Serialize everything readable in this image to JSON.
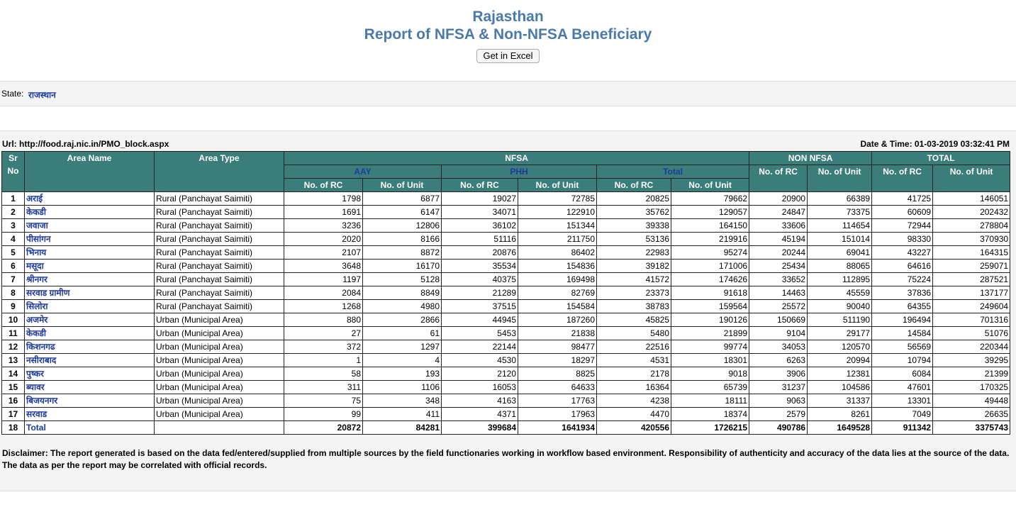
{
  "header": {
    "title": "Rajasthan",
    "subtitle": "Report of NFSA & Non-NFSA Beneficiary",
    "excel_button": "Get in Excel"
  },
  "state": {
    "label": "State:",
    "value": "राजस्थान"
  },
  "url": "Url: http://food.raj.nic.in/PMO_block.aspx",
  "datetime": "Date & Time: 01-03-2019 03:32:41 PM",
  "table": {
    "h_sr": "Sr No",
    "h_area": "Area Name",
    "h_type": "Area Type",
    "h_nfsa": "NFSA",
    "h_non": "NON NFSA",
    "h_total": "TOTAL",
    "h_aay": "AAY",
    "h_phh": "PHH",
    "h_ntotal": "Total",
    "rc": "No. of RC",
    "unit": "No. of Unit",
    "rows": [
      [
        "1",
        "अराई",
        "Rural (Panchayat Saimiti)",
        "1798",
        "6877",
        "19027",
        "72785",
        "20825",
        "79662",
        "20900",
        "66389",
        "41725",
        "146051"
      ],
      [
        "2",
        "केकडी",
        "Rural (Panchayat Saimiti)",
        "1691",
        "6147",
        "34071",
        "122910",
        "35762",
        "129057",
        "24847",
        "73375",
        "60609",
        "202432"
      ],
      [
        "3",
        "जवाजा",
        "Rural (Panchayat Saimiti)",
        "3236",
        "12806",
        "36102",
        "151344",
        "39338",
        "164150",
        "33606",
        "114654",
        "72944",
        "278804"
      ],
      [
        "4",
        "पीसांगन",
        "Rural (Panchayat Saimiti)",
        "2020",
        "8166",
        "51116",
        "211750",
        "53136",
        "219916",
        "45194",
        "151014",
        "98330",
        "370930"
      ],
      [
        "5",
        "भिनाय",
        "Rural (Panchayat Saimiti)",
        "2107",
        "8872",
        "20876",
        "86402",
        "22983",
        "95274",
        "20244",
        "69041",
        "43227",
        "164315"
      ],
      [
        "6",
        "मसूदा",
        "Rural (Panchayat Saimiti)",
        "3648",
        "16170",
        "35534",
        "154836",
        "39182",
        "171006",
        "25434",
        "88065",
        "64616",
        "259071"
      ],
      [
        "7",
        "श्रीनगर",
        "Rural (Panchayat Saimiti)",
        "1197",
        "5128",
        "40375",
        "169498",
        "41572",
        "174626",
        "33652",
        "112895",
        "75224",
        "287521"
      ],
      [
        "8",
        "सरवाड ग्रामीण",
        "Rural (Panchayat Saimiti)",
        "2084",
        "8849",
        "21289",
        "82769",
        "23373",
        "91618",
        "14463",
        "45559",
        "37836",
        "137177"
      ],
      [
        "9",
        "सिलोरा",
        "Rural (Panchayat Saimiti)",
        "1268",
        "4980",
        "37515",
        "154584",
        "38783",
        "159564",
        "25572",
        "90040",
        "64355",
        "249604"
      ],
      [
        "10",
        "अजमेर",
        "Urban (Municipal Area)",
        "880",
        "2866",
        "44945",
        "187260",
        "45825",
        "190126",
        "150669",
        "511190",
        "196494",
        "701316"
      ],
      [
        "11",
        "केकडी",
        "Urban (Municipal Area)",
        "27",
        "61",
        "5453",
        "21838",
        "5480",
        "21899",
        "9104",
        "29177",
        "14584",
        "51076"
      ],
      [
        "12",
        "किशनगढ",
        "Urban (Municipal Area)",
        "372",
        "1297",
        "22144",
        "98477",
        "22516",
        "99774",
        "34053",
        "120570",
        "56569",
        "220344"
      ],
      [
        "13",
        "नसीराबाद",
        "Urban (Municipal Area)",
        "1",
        "4",
        "4530",
        "18297",
        "4531",
        "18301",
        "6263",
        "20994",
        "10794",
        "39295"
      ],
      [
        "14",
        "पुष्कर",
        "Urban (Municipal Area)",
        "58",
        "193",
        "2120",
        "8825",
        "2178",
        "9018",
        "3906",
        "12381",
        "6084",
        "21399"
      ],
      [
        "15",
        "ब्यावर",
        "Urban (Municipal Area)",
        "311",
        "1106",
        "16053",
        "64633",
        "16364",
        "65739",
        "31237",
        "104586",
        "47601",
        "170325"
      ],
      [
        "16",
        "बिजयनगर",
        "Urban (Municipal Area)",
        "75",
        "348",
        "4163",
        "17763",
        "4238",
        "18111",
        "9063",
        "31337",
        "13301",
        "49448"
      ],
      [
        "17",
        "सरवाड",
        "Urban (Municipal Area)",
        "99",
        "411",
        "4371",
        "17963",
        "4470",
        "18374",
        "2579",
        "8261",
        "7049",
        "26635"
      ]
    ],
    "total": [
      "18",
      "Total",
      "",
      "20872",
      "84281",
      "399684",
      "1641934",
      "420556",
      "1726215",
      "490786",
      "1649528",
      "911342",
      "3375743"
    ]
  },
  "disclaimer": "Disclaimer: The report generated is based on the data fed/entered/supplied from multiple sources by the field functionaries working in workflow based environment. Responsibility of authenticity and accuracy of the data lies at the source of the data. The data as per the report may be correlated with official records."
}
